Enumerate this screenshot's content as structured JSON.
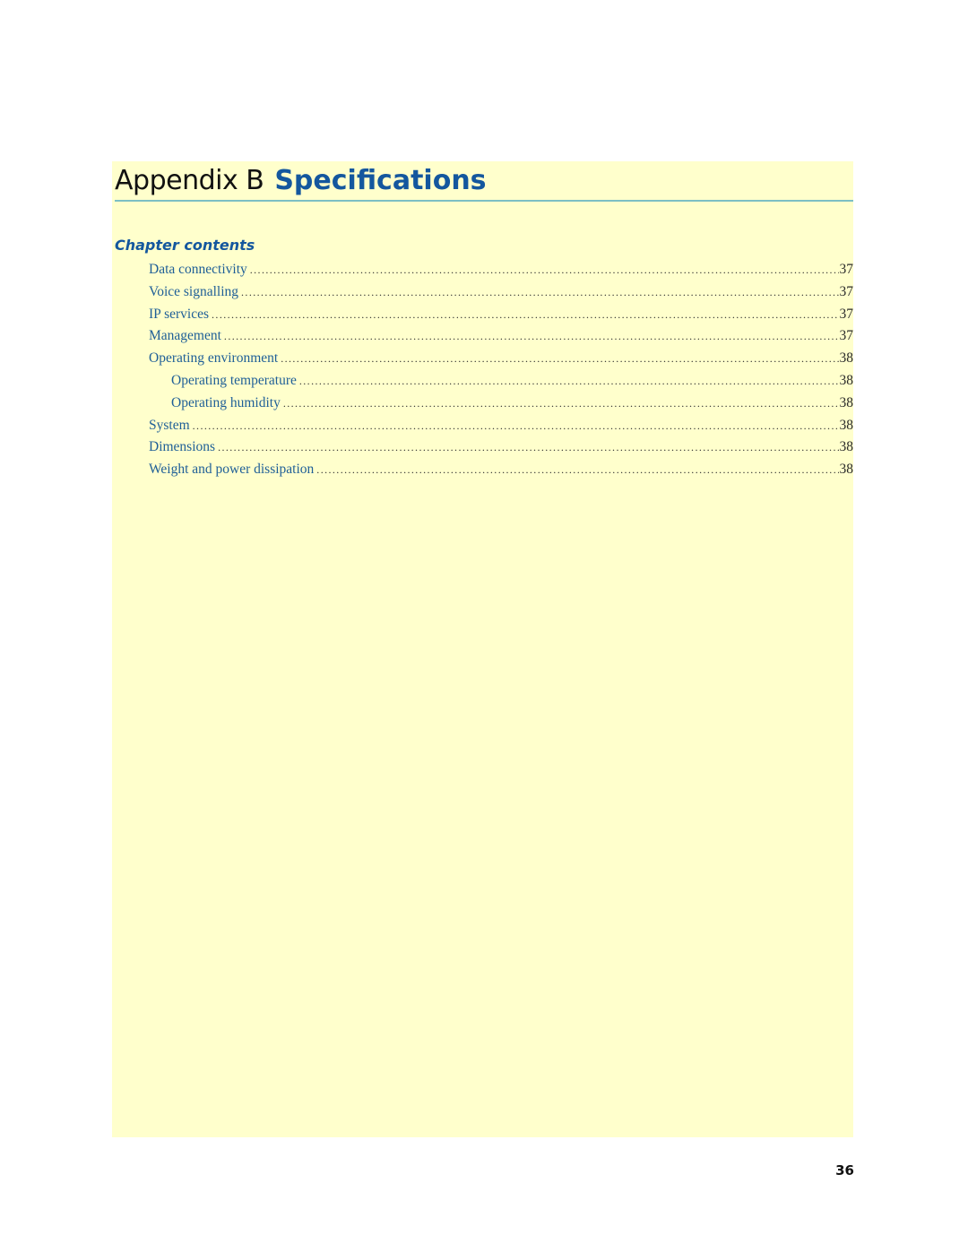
{
  "header": {
    "prefix": "Appendix B",
    "title": "Specifications"
  },
  "chapter_contents": {
    "heading": "Chapter contents",
    "items": [
      {
        "label": "Data connectivity",
        "page": "37",
        "level": 1
      },
      {
        "label": "Voice signalling",
        "page": "37",
        "level": 1
      },
      {
        "label": "IP services",
        "page": "37",
        "level": 1
      },
      {
        "label": "Management",
        "page": "37",
        "level": 1
      },
      {
        "label": "Operating environment",
        "page": "38",
        "level": 1
      },
      {
        "label": "Operating temperature",
        "page": "38",
        "level": 2
      },
      {
        "label": "Operating humidity",
        "page": "38",
        "level": 2
      },
      {
        "label": "System",
        "page": "38",
        "level": 1
      },
      {
        "label": "Dimensions",
        "page": "38",
        "level": 1
      },
      {
        "label": "Weight and power dissipation",
        "page": "38",
        "level": 1
      }
    ]
  },
  "footer": {
    "page_number": "36"
  },
  "colors": {
    "panel_background": "#ffffcc",
    "accent_blue": "#14579e",
    "rule": "#7cbfc4"
  }
}
